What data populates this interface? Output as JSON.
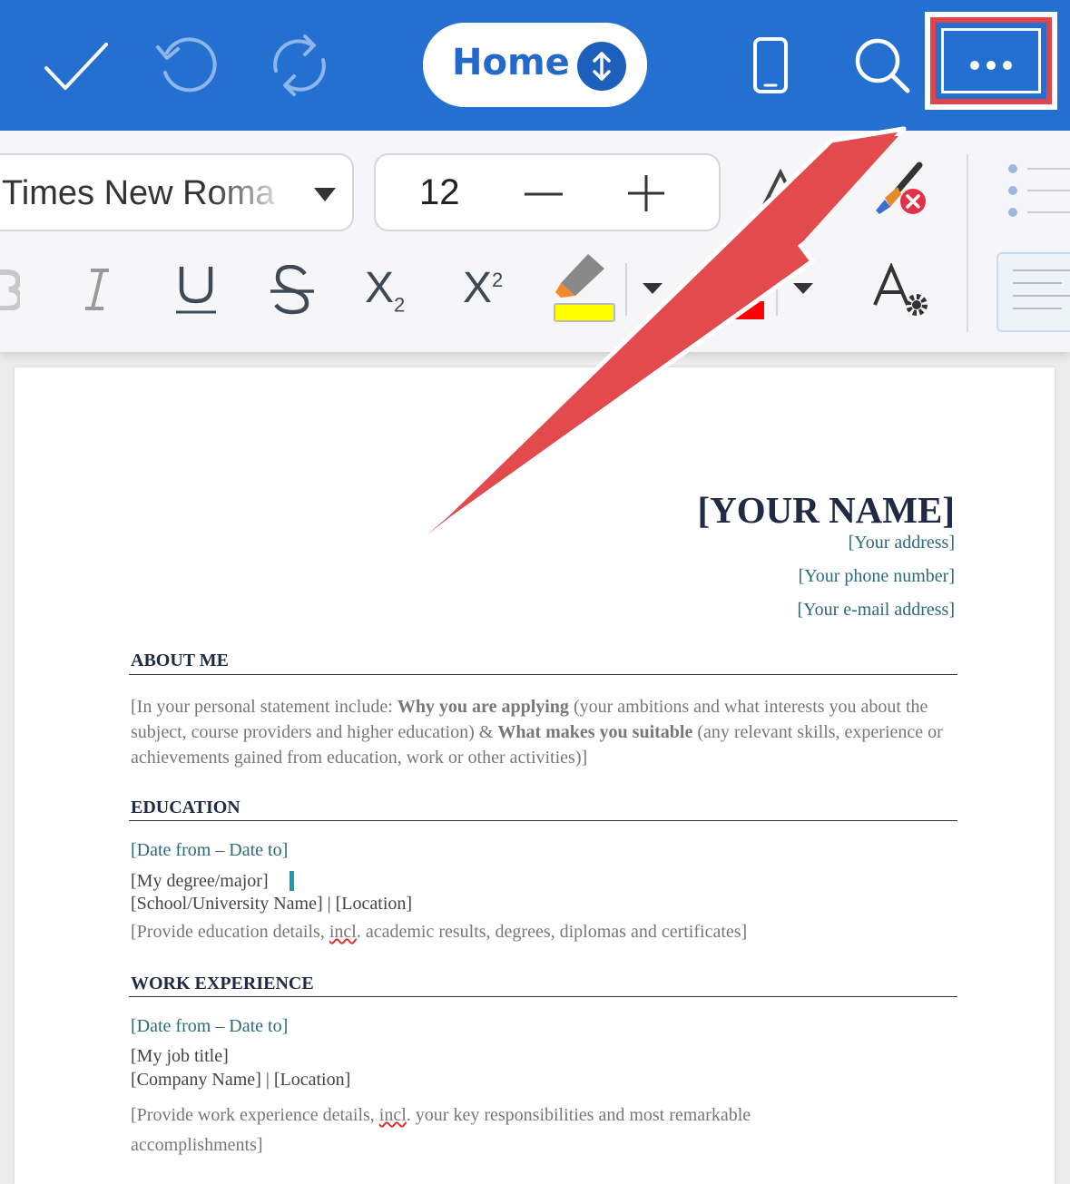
{
  "toolbar": {
    "home_label": "Home",
    "icons": [
      "checkmark-icon",
      "undo-icon",
      "redo-icon",
      "expand-collapse-icon",
      "phone-view-icon",
      "search-icon",
      "more-icon"
    ]
  },
  "ribbon": {
    "font_name": "Times New Roman",
    "font_size": "12",
    "highlight_color": "#ffff00",
    "font_color": "#ff0000",
    "subscript_digit": "2",
    "superscript_digit": "2"
  },
  "document": {
    "name": "[YOUR NAME]",
    "address": "[Your address]",
    "phone": "[Your phone number]",
    "email": "[Your e-mail address]",
    "about": {
      "title": "ABOUT ME",
      "t1": "[In your personal statement include: ",
      "b1": "Why you are applying",
      "t2": " (your ambitions and what interests you about the subject, course providers and higher education) & ",
      "b2": "What makes you suitable",
      "t3": " (any relevant skills, experience or achievements gained from education, work or other activities)]"
    },
    "education": {
      "title": "EDUCATION",
      "dates": "[Date from – Date to]",
      "degree": "[My degree/major]",
      "school": "[School/University Name] | [Location]",
      "details_before": "[Provide education details, ",
      "details_mark": "incl",
      "details_after": ". academic results, degrees, diplomas and certificates]"
    },
    "work": {
      "title": "WORK EXPERIENCE",
      "dates": "[Date from – Date to]",
      "job": "[My job title]",
      "company": "[Company Name] | [Location]",
      "details_before": "[Provide work experience details, ",
      "details_mark": "incl",
      "details_after": ". your key responsibilities and most remarkable accomplishments]"
    }
  },
  "colors": {
    "topbar": "#2470d1",
    "highlight_box": "#e0454b",
    "arrow": "#e34a4e"
  }
}
